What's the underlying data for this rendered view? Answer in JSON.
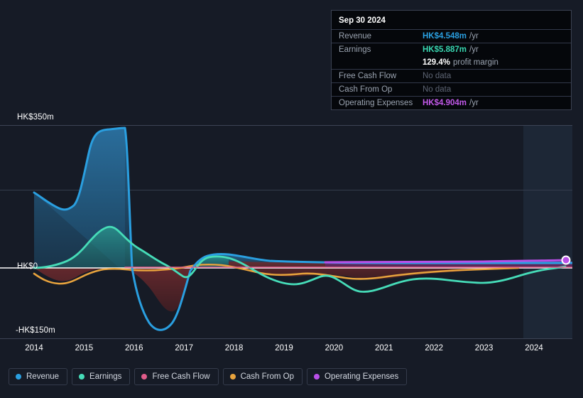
{
  "axes": {
    "y_top_label": "HK$350m",
    "y_zero_label": "HK$0",
    "y_bottom_label": "-HK$150m"
  },
  "tooltip": {
    "date": "Sep 30 2024",
    "rows": [
      {
        "key": "Revenue",
        "value": "HK$4.548m",
        "unit": "/yr",
        "color": "#2a9fe0"
      },
      {
        "key": "Earnings",
        "value": "HK$5.887m",
        "unit": "/yr",
        "color": "#38d6b0"
      },
      {
        "key": "",
        "value": "129.4%",
        "unit": "profit margin",
        "color": "#ffffff"
      },
      {
        "key": "Free Cash Flow",
        "value": "No data",
        "unit": "",
        "color": "#5d6473"
      },
      {
        "key": "Cash From Op",
        "value": "No data",
        "unit": "",
        "color": "#5d6473"
      },
      {
        "key": "Operating Expenses",
        "value": "HK$4.904m",
        "unit": "/yr",
        "color": "#c159e8"
      }
    ]
  },
  "legend": [
    {
      "label": "Revenue",
      "color": "#2a9fe0"
    },
    {
      "label": "Earnings",
      "color": "#46dcb8"
    },
    {
      "label": "Free Cash Flow",
      "color": "#e05c8a"
    },
    {
      "label": "Cash From Op",
      "color": "#e8a33d"
    },
    {
      "label": "Operating Expenses",
      "color": "#b84fe8"
    }
  ],
  "chart_data": {
    "type": "area",
    "title": "",
    "xlabel": "",
    "ylabel": "HK$",
    "ylim": [
      -150,
      350
    ],
    "grid": true,
    "legend_position": "bottom",
    "currency": "HK$",
    "unit": "m",
    "x_tick_labels": [
      "2014",
      "2015",
      "2016",
      "2017",
      "2018",
      "2019",
      "2020",
      "2021",
      "2022",
      "2023",
      "2024"
    ],
    "x": [
      2014.0,
      2014.5,
      2015.0,
      2015.3,
      2015.6,
      2016.0,
      2016.3,
      2016.6,
      2017.0,
      2017.4,
      2017.8,
      2018.2,
      2018.6,
      2019.0,
      2019.4,
      2019.8,
      2020.2,
      2020.6,
      2021.0,
      2021.5,
      2022.0,
      2022.5,
      2023.0,
      2023.5,
      2024.0,
      2024.75
    ],
    "series": [
      {
        "name": "Revenue",
        "color": "#2a9fe0",
        "fill": "#1d4a69",
        "values": [
          150,
          125,
          330,
          338,
          340,
          8,
          -60,
          -145,
          -30,
          16,
          20,
          7,
          5,
          4,
          4,
          4,
          4,
          4,
          4,
          4,
          4,
          4,
          4,
          4,
          4,
          4.548
        ]
      },
      {
        "name": "Earnings",
        "color": "#46dcb8",
        "fill": "#1f6a68",
        "values": [
          -4,
          -6,
          30,
          52,
          44,
          32,
          22,
          -16,
          -23,
          12,
          14,
          -2,
          -12,
          -17,
          -13,
          -20,
          -28,
          -26,
          -20,
          -13,
          -9,
          -13,
          -11,
          -4,
          1,
          5.887
        ]
      },
      {
        "name": "Free Cash Flow",
        "color": "#e05c8a",
        "fill": "#5e2433",
        "values": [
          null,
          null,
          null,
          null,
          null,
          null,
          null,
          null,
          null,
          null,
          null,
          null,
          null,
          null,
          null,
          null,
          null,
          null,
          null,
          null,
          null,
          null,
          null,
          null,
          null,
          null
        ]
      },
      {
        "name": "Cash From Op",
        "color": "#e8a33d",
        "fill": "#5e3a1c",
        "values": [
          -14,
          -26,
          -20,
          -10,
          -4,
          -2,
          -6,
          -10,
          -6,
          2,
          2,
          -2,
          -6,
          -8,
          -7,
          -9,
          -14,
          -13,
          -10,
          -8,
          -7,
          -7,
          -6,
          -4,
          null,
          null
        ]
      },
      {
        "name": "Operating Expenses",
        "color": "#b84fe8",
        "fill": "#4a2060",
        "values": [
          null,
          null,
          null,
          null,
          null,
          null,
          null,
          null,
          null,
          null,
          null,
          null,
          null,
          7,
          7,
          7,
          6,
          6,
          6,
          6,
          6,
          5,
          5,
          5,
          5,
          4.904
        ]
      }
    ],
    "highlight_band": {
      "from": 2023.6,
      "to": 2024.75,
      "label": ""
    },
    "marker": {
      "x": 2024.75,
      "value": 4.904,
      "series": "Operating Expenses",
      "color": "#b84fe8"
    }
  }
}
